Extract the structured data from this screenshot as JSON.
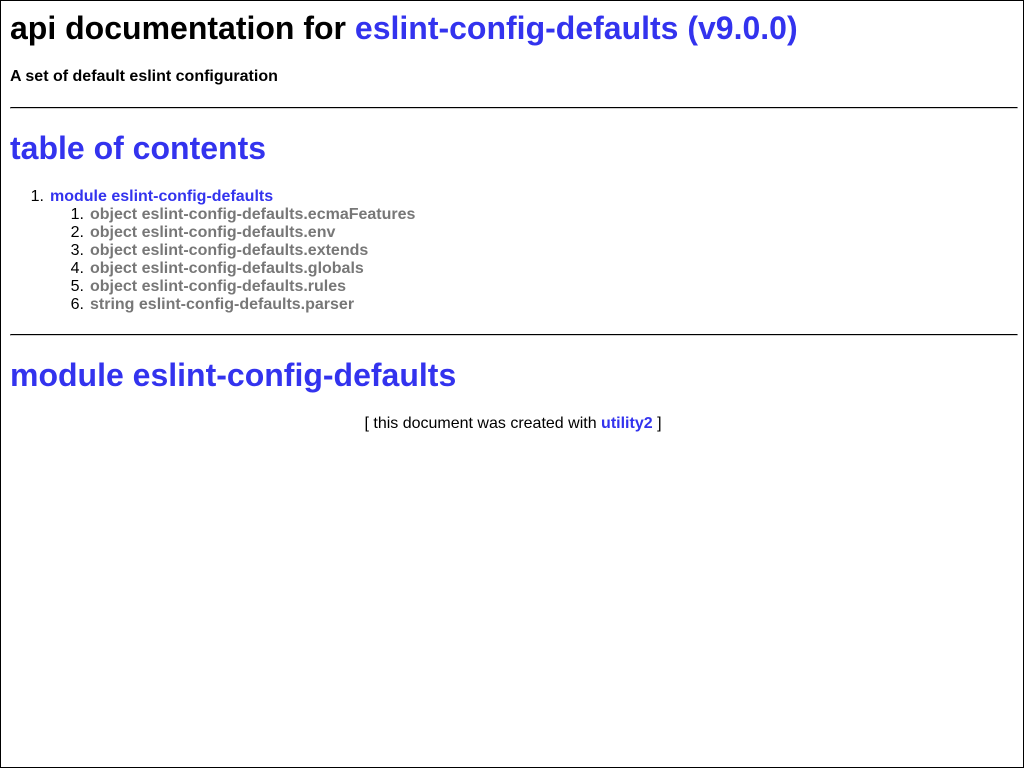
{
  "header": {
    "title_prefix": "api documentation for",
    "title_link": "eslint-config-defaults (v9.0.0)",
    "description": "A set of default eslint configuration"
  },
  "toc": {
    "heading": "table of contents",
    "module": {
      "number": "1.",
      "label": "module eslint-config-defaults"
    },
    "items": [
      {
        "number": "1.",
        "label": "object eslint-config-defaults.ecmaFeatures"
      },
      {
        "number": "2.",
        "label": "object eslint-config-defaults.env"
      },
      {
        "number": "3.",
        "label": "object eslint-config-defaults.extends"
      },
      {
        "number": "4.",
        "label": "object eslint-config-defaults.globals"
      },
      {
        "number": "5.",
        "label": "object eslint-config-defaults.rules"
      },
      {
        "number": "6.",
        "label": "string eslint-config-defaults.parser"
      }
    ]
  },
  "module_section": {
    "heading": "module eslint-config-defaults"
  },
  "footer": {
    "prefix": "[ this document was created with",
    "link": "utility2",
    "suffix": "]"
  },
  "colors": {
    "link": "#3333ee",
    "muted_link": "#777777",
    "text": "#000000"
  }
}
